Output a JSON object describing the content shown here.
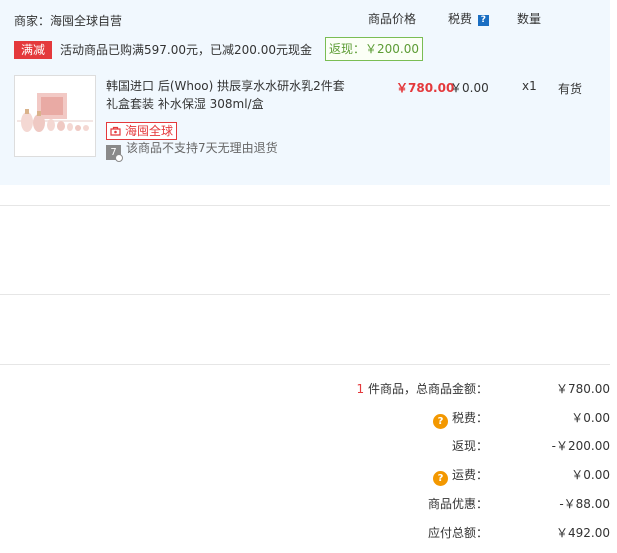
{
  "merchant": {
    "label": "商家：",
    "name": "海囤全球自营"
  },
  "columns": {
    "price": "商品价格",
    "tax": "税费",
    "tax_help": "?",
    "quantity": "数量"
  },
  "promotion": {
    "badge": "满减",
    "text": "活动商品已购满597.00元，已减200.00元现金",
    "rebate": "返现：￥200.00"
  },
  "product": {
    "title": "韩国进口 后(Whoo) 拱辰享水水研水乳2件套礼盒套装 补水保湿 308ml/盒",
    "global_tag": "海囤全球",
    "return_icon_text": "7",
    "return_notice": "该商品不支持7天无理由退货",
    "price": "￥780.00",
    "tax": "￥0.00",
    "quantity": "x1",
    "stock": "有货"
  },
  "summary": {
    "count": "1",
    "items_label": " 件商品，总商品金额：",
    "items_total": "￥780.00",
    "tax_icon": "?",
    "tax_label": "税费：",
    "tax_value": "￥0.00",
    "rebate_label": "返现：",
    "rebate_value": "-￥200.00",
    "shipping_icon": "?",
    "shipping_label": "运费：",
    "shipping_value": "￥0.00",
    "discount_label": "商品优惠：",
    "discount_value": "-￥88.00",
    "payable_label": "应付总额：",
    "payable_value": "￥492.00"
  },
  "colors": {
    "accent_red": "#e4393c",
    "rebate_green": "#7abd54",
    "help_blue": "#1a6ec2",
    "info_orange": "#f39800",
    "panel_bg": "#f1f8fe"
  }
}
